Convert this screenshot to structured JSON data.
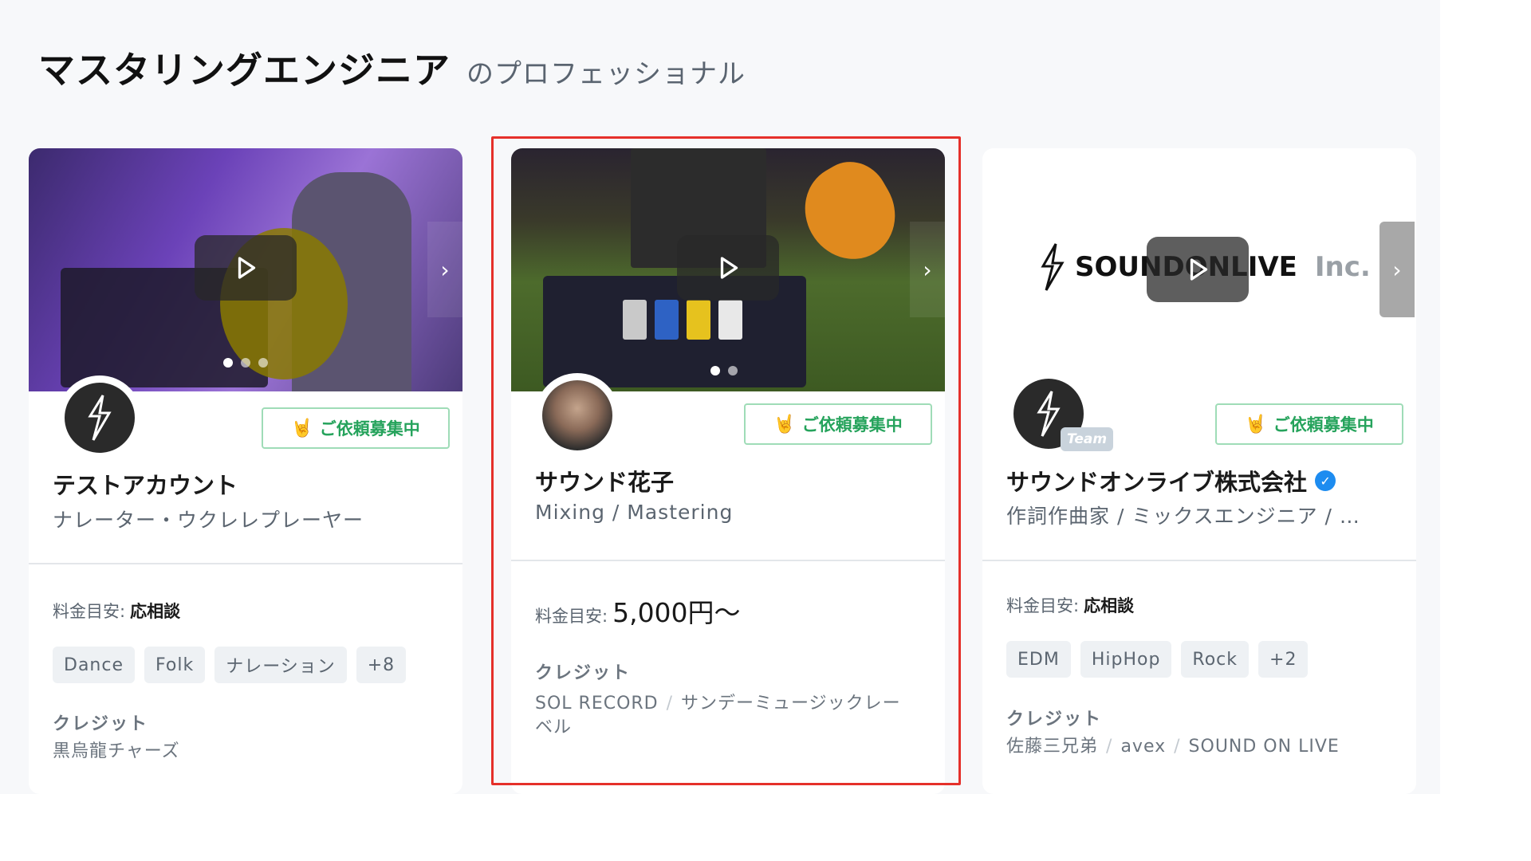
{
  "heading": {
    "main": "マスタリングエンジニア",
    "sub": "のプロフェッショナル"
  },
  "cards": [
    {
      "name": "テストアカウント",
      "role": "ナレーター・ウクレレプレーヤー",
      "recruit": "ご依頼募集中",
      "price_label": "料金目安:",
      "price": "応相談",
      "tags": [
        "Dance",
        "Folk",
        "ナレーション",
        "+8"
      ],
      "credit_label": "クレジット",
      "credits": [
        "黒烏龍チャーズ"
      ]
    },
    {
      "name": "サウンド花子",
      "role": "Mixing / Mastering",
      "recruit": "ご依頼募集中",
      "price_label": "料金目安:",
      "price": "5,000円〜",
      "credit_label": "クレジット",
      "credits": [
        "SOL RECORD",
        "サンデーミュージックレーベル"
      ]
    },
    {
      "name": "サウンドオンライブ株式会社",
      "role": "作詞作曲家 / ミックスエンジニア / …",
      "recruit": "ご依頼募集中",
      "team_badge": "Team",
      "logo_text": "SOUNDONLIVE",
      "logo_inc": "Inc.",
      "price_label": "料金目安:",
      "price": "応相談",
      "tags": [
        "EDM",
        "HipHop",
        "Rock",
        "+2"
      ],
      "credit_label": "クレジット",
      "credits": [
        "佐藤三兄弟",
        "avex",
        "SOUND ON LIVE"
      ]
    }
  ],
  "icons": {
    "play": "play-icon",
    "next": "chevron-right-icon",
    "recruit": "rock-hand-icon",
    "verified": "verified-check-icon"
  },
  "colors": {
    "highlight": "#e5302a",
    "recruit_green": "#26a35c",
    "verified_blue": "#1d8cf0"
  }
}
